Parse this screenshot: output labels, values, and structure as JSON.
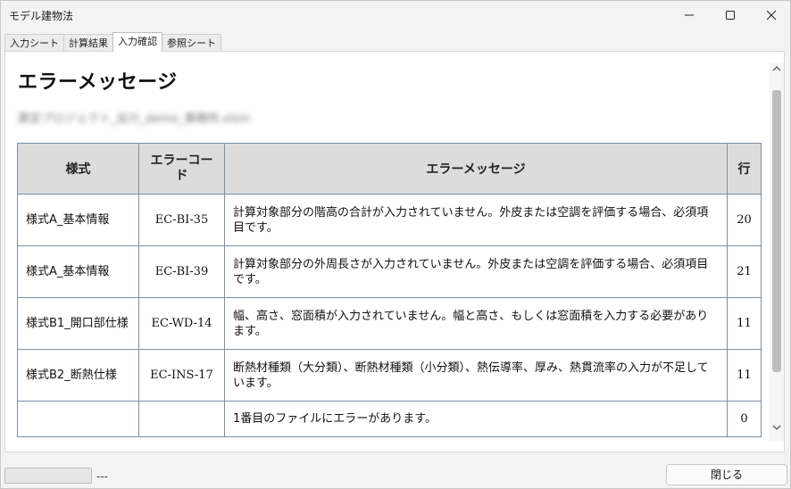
{
  "window": {
    "title": "モデル建物法"
  },
  "tabs": [
    {
      "label": "入力シート",
      "active": false
    },
    {
      "label": "計算結果",
      "active": false
    },
    {
      "label": "入力確認",
      "active": true
    },
    {
      "label": "参照シート",
      "active": false
    }
  ],
  "main": {
    "heading": "エラーメッセージ",
    "file_path": "算定プロジェクト_出力_demo_事務所.xlsm"
  },
  "table": {
    "headers": {
      "form": "様式",
      "code": "エラーコード",
      "message": "エラーメッセージ",
      "row": "行"
    },
    "rows": [
      {
        "form": "様式A_基本情報",
        "code": "EC-BI-35",
        "message": "計算対象部分の階高の合計が入力されていません。外皮または空調を評価する場合、必須項目です。",
        "row": "20"
      },
      {
        "form": "様式A_基本情報",
        "code": "EC-BI-39",
        "message": "計算対象部分の外周長さが入力されていません。外皮または空調を評価する場合、必須項目です。",
        "row": "21"
      },
      {
        "form": "様式B1_開口部仕様",
        "code": "EC-WD-14",
        "message": "幅、高さ、窓面積が入力されていません。幅と高さ、もしくは窓面積を入力する必要があります。",
        "row": "11"
      },
      {
        "form": "様式B2_断熱仕様",
        "code": "EC-INS-17",
        "message": "断熱材種類（大分類）、断熱材種類（小分類）、熱伝導率、厚み、熱貫流率の入力が不足しています。",
        "row": "11"
      },
      {
        "form": "",
        "code": "",
        "message": "1番目のファイルにエラーがあります。",
        "row": "0"
      }
    ]
  },
  "status": {
    "text": "---"
  },
  "footer": {
    "close_label": "閉じる"
  },
  "icons": {
    "minimize": "minimize-icon",
    "maximize": "maximize-icon",
    "close": "close-icon"
  }
}
